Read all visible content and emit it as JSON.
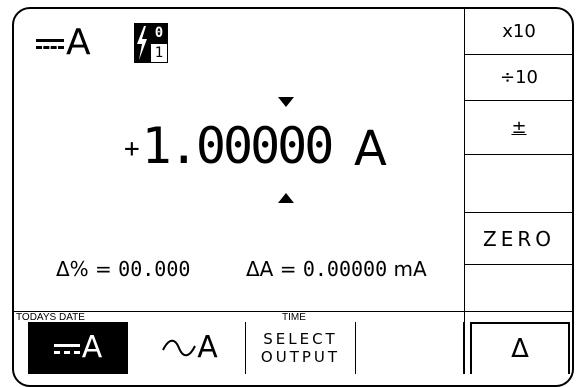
{
  "display": {
    "mode_letter": "A",
    "range_top": "0",
    "range_bottom": "1",
    "sign": "+",
    "value": "1.00000",
    "unit": "A",
    "delta_pct_label": "Δ% = ",
    "delta_pct_value": "00.000",
    "delta_abs_label": "ΔA = ",
    "delta_abs_value": "0.00000",
    "delta_abs_unit": " mA",
    "todays_date_label": "TODAYS DATE",
    "time_label": "TIME"
  },
  "softkeys": [
    {
      "label": "x10"
    },
    {
      "label": "÷10"
    },
    {
      "label": "±"
    },
    {
      "label": ""
    },
    {
      "label": "ZERO"
    },
    {
      "label": ""
    }
  ],
  "bottom": {
    "dc_label": "A",
    "ac_label": "A",
    "select_line1": "SELECT",
    "select_line2": "OUTPUT",
    "delta_label": "Δ"
  },
  "icons": [
    "dc-current-icon",
    "range-lightning-icon",
    "ac-wave-icon",
    "cursor-up-icon",
    "cursor-down-icon"
  ],
  "colors": {
    "foreground": "#000000",
    "background": "#ffffff",
    "highlight": "#000000"
  }
}
